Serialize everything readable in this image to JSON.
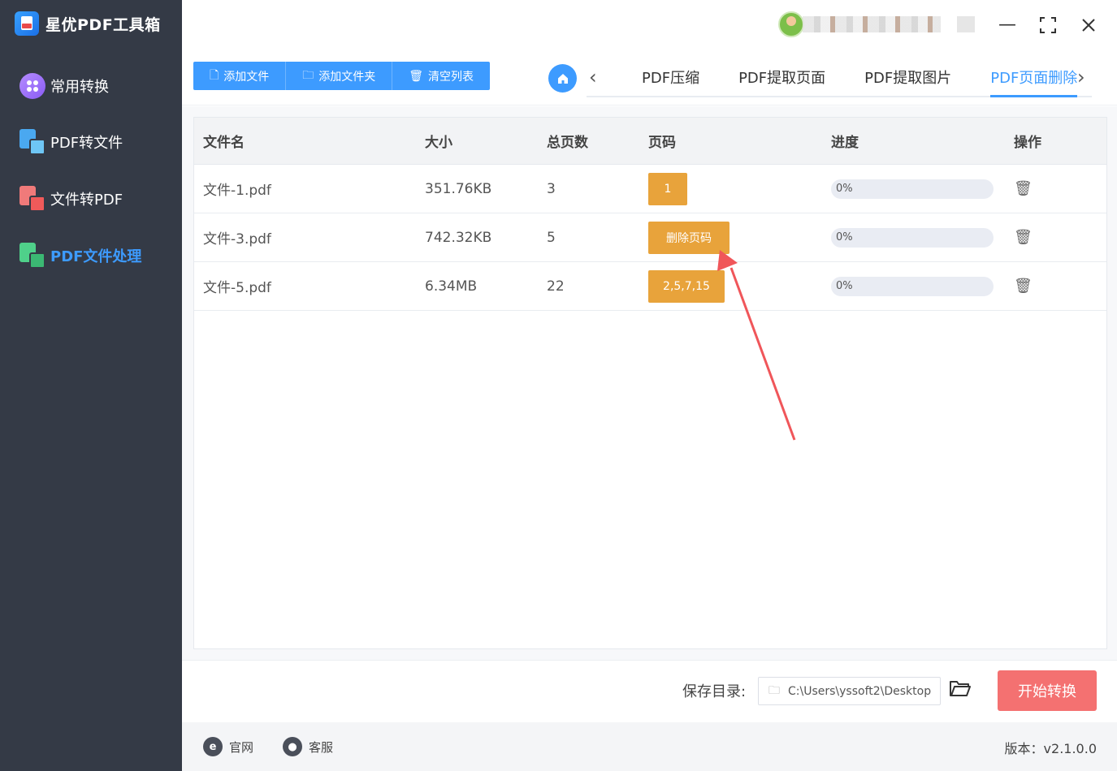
{
  "app": {
    "title": "星优PDF工具箱"
  },
  "sidebar": {
    "items": [
      {
        "label": "常用转换",
        "icon": "grid-circle-icon"
      },
      {
        "label": "PDF转文件",
        "icon": "pdf-to-file-icon"
      },
      {
        "label": "文件转PDF",
        "icon": "file-to-pdf-icon"
      },
      {
        "label": "PDF文件处理",
        "icon": "pdf-process-icon",
        "active": true
      }
    ]
  },
  "toolbar": {
    "add_file": "添加文件",
    "add_folder": "添加文件夹",
    "clear_list": "清空列表"
  },
  "tabs": [
    {
      "label": "PDF压缩"
    },
    {
      "label": "PDF提取页面"
    },
    {
      "label": "PDF提取图片"
    },
    {
      "label": "PDF页面删除",
      "active": true
    }
  ],
  "table": {
    "headers": {
      "name": "文件名",
      "size": "大小",
      "pages": "总页数",
      "page_code": "页码",
      "progress": "进度",
      "action": "操作"
    },
    "rows": [
      {
        "name": "文件-1.pdf",
        "size": "351.76KB",
        "pages": "3",
        "page_code": "1",
        "progress": "0%"
      },
      {
        "name": "文件-3.pdf",
        "size": "742.32KB",
        "pages": "5",
        "page_code": "删除页码",
        "progress": "0%"
      },
      {
        "name": "文件-5.pdf",
        "size": "6.34MB",
        "pages": "22",
        "page_code": "2,5,7,15",
        "progress": "0%"
      }
    ]
  },
  "save": {
    "label": "保存目录:",
    "path": "C:\\Users\\yssoft2\\Desktop",
    "start_button": "开始转换"
  },
  "footer": {
    "website": "官网",
    "support": "客服",
    "version": "版本：v2.1.0.0"
  },
  "colors": {
    "accent": "#3d9bff",
    "sidebar": "#343a46",
    "page_button": "#e8a33b",
    "start_button": "#f47171",
    "annotation_arrow": "#f0565a"
  }
}
